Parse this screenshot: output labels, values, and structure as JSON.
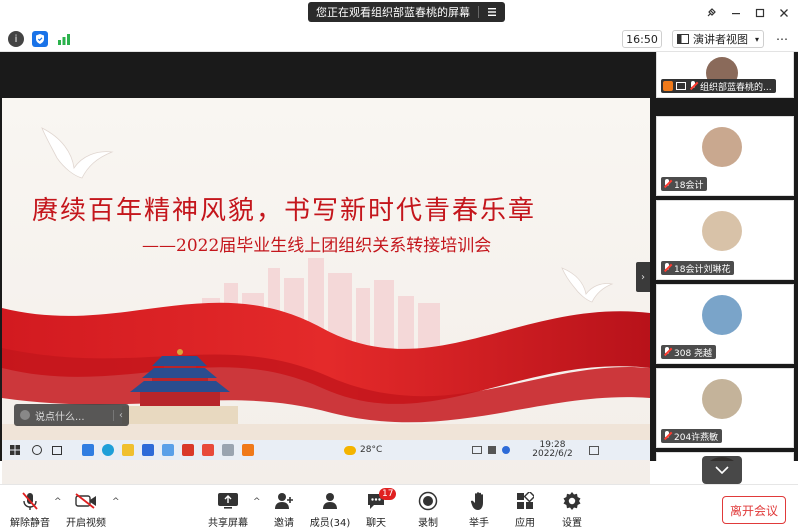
{
  "titlebar": {
    "sharing_notice": "您正在观看组织部蓝春桃的屏幕"
  },
  "toolbar": {
    "time": "16:50",
    "view_label": "演讲者视图",
    "more_label": "⋯"
  },
  "slide": {
    "title": "赓续百年精神风貌，书写新时代青春乐章",
    "subtitle": "——2022届毕业生线上团组织关系转接培训会",
    "chat_placeholder": "说点什么...",
    "taskbar": {
      "weather": "28°C",
      "time": "19:28",
      "date": "2022/6/2"
    }
  },
  "participants": [
    {
      "name": "组织部蓝春桃的...",
      "avatar_color": "#8a6a5a"
    },
    {
      "name": "18会计",
      "avatar_color": "#c9a88f"
    },
    {
      "name": "18会计刘琳花",
      "avatar_color": "#d8c2a8"
    },
    {
      "name": "308  尧越",
      "avatar_color": "#7aa4c9"
    },
    {
      "name": "204许燕敏",
      "avatar_color": "#c4b39a"
    }
  ],
  "bottom": {
    "unmute": "解除静音",
    "start_video": "开启视频",
    "share_screen": "共享屏幕",
    "invite": "邀请",
    "members": "成员(34)",
    "chat": "聊天",
    "chat_badge": "17",
    "record": "录制",
    "raise_hand": "举手",
    "apps": "应用",
    "settings": "设置",
    "leave": "离开会议"
  },
  "colors": {
    "accent_red": "#c4161c",
    "leave_red": "#e03a3a",
    "dark_bg": "#1a1a1a"
  }
}
